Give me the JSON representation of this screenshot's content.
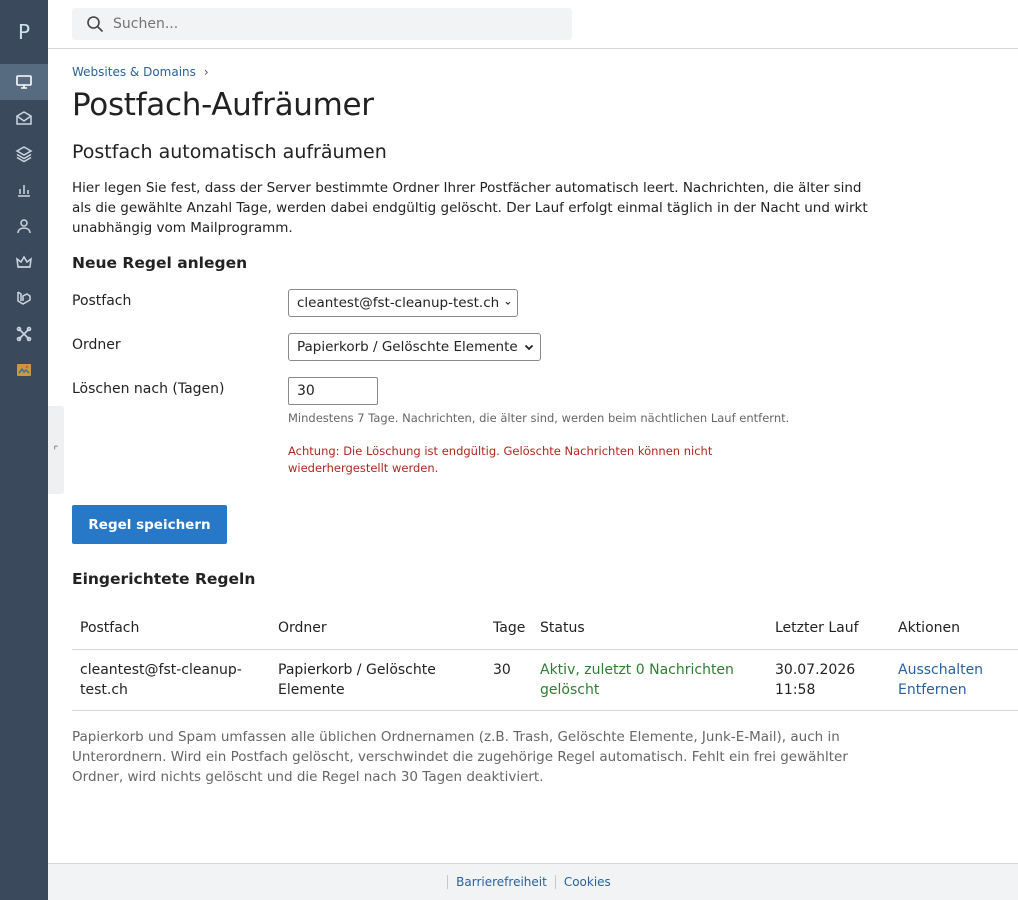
{
  "sidebar": {
    "logo": "P",
    "items": [
      {
        "icon": "monitor-icon",
        "active": true
      },
      {
        "icon": "mail-icon",
        "active": false
      },
      {
        "icon": "layers-icon",
        "active": false
      },
      {
        "icon": "bar-chart-icon",
        "active": false
      },
      {
        "icon": "user-icon",
        "active": false
      },
      {
        "icon": "crown-icon",
        "active": false
      },
      {
        "icon": "laravel-icon",
        "active": false
      },
      {
        "icon": "joomla-icon",
        "active": false
      },
      {
        "icon": "extension-icon",
        "active": false
      }
    ],
    "accent": "#3a4a5c"
  },
  "search": {
    "placeholder": "Suchen..."
  },
  "breadcrumb": {
    "link": "Websites & Domains"
  },
  "page": {
    "title": "Postfach-Aufräumer",
    "subtitle": "Postfach automatisch aufräumen",
    "intro": "Hier legen Sie fest, dass der Server bestimmte Ordner Ihrer Postfächer automatisch leert. Nachrichten, die älter sind als die gewählte Anzahl Tage, werden dabei endgültig gelöscht. Der Lauf erfolgt einmal täglich in der Nacht und wirkt unabhängig vom Mailprogramm."
  },
  "form": {
    "heading": "Neue Regel anlegen",
    "mailbox_label": "Postfach",
    "mailbox_value": "cleantest@fst-cleanup-test.ch",
    "folder_label": "Ordner",
    "folder_value": "Papierkorb / Gelöschte Elemente",
    "days_label": "Löschen nach (Tagen)",
    "days_value": "30",
    "days_hint": "Mindestens 7 Tage. Nachrichten, die älter sind, werden beim nächtlichen Lauf entfernt.",
    "warning": "Achtung: Die Löschung ist endgültig. Gelöschte Nachrichten können nicht wiederhergestellt werden.",
    "save_label": "Regel speichern"
  },
  "rules": {
    "heading": "Eingerichtete Regeln",
    "columns": [
      "Postfach",
      "Ordner",
      "Tage",
      "Status",
      "Letzter Lauf",
      "Aktionen"
    ],
    "rows": [
      {
        "mailbox": "cleantest@fst-cleanup-test.ch",
        "folder": "Papierkorb / Gelöschte Elemente",
        "days": "30",
        "status": "Aktiv, zuletzt 0 Nachrichten gelöscht",
        "last_run": "30.07.2026 11:58",
        "action_disable": "Ausschalten",
        "action_remove": "Entfernen"
      }
    ]
  },
  "footnote": "Papierkorb und Spam umfassen alle üblichen Ordnernamen (z.B. Trash, Gelöschte Elemente, Junk-E-Mail), auch in Unterordnern. Wird ein Postfach gelöscht, verschwindet die zugehörige Regel automatisch. Fehlt ein frei gewählter Ordner, wird nichts gelöscht und die Regel nach 30 Tagen deaktiviert.",
  "footer": {
    "accessibility": "Barrierefreiheit",
    "cookies": "Cookies"
  },
  "colors": {
    "link": "#28629c",
    "primary": "#2878c8",
    "success": "#2e7d32",
    "danger": "#b3261e"
  }
}
